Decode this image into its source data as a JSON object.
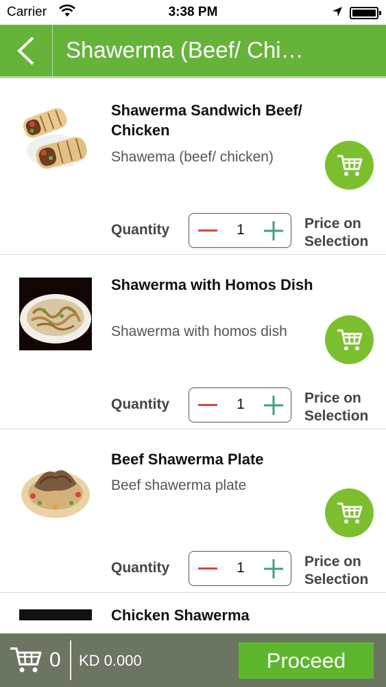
{
  "status_bar": {
    "carrier": "Carrier",
    "time": "3:38 PM"
  },
  "nav": {
    "title": "Shawerma (Beef/ Chi…"
  },
  "products": [
    {
      "name": "Shawerma Sandwich Beef/ Chicken",
      "description": "Shawema (beef/ chicken)",
      "quantity_label": "Quantity",
      "quantity": "1",
      "price": "Price on Selection",
      "image": "shawerma-sandwich-photo"
    },
    {
      "name": "Shawerma with Homos Dish",
      "description": "Shawerma with homos dish",
      "quantity_label": "Quantity",
      "quantity": "1",
      "price": "Price on Selection",
      "image": "shawerma-homos-dish-photo"
    },
    {
      "name": "Beef Shawerma Plate",
      "description": "Beef shawerma plate",
      "quantity_label": "Quantity",
      "quantity": "1",
      "price": "Price on Selection",
      "image": "beef-shawerma-plate-photo"
    },
    {
      "name": "Chicken Shawerma",
      "image": "chicken-shawerma-photo"
    }
  ],
  "bottom_bar": {
    "cart_count": "0",
    "total": "KD 0.000",
    "proceed_label": "Proceed"
  },
  "colors": {
    "brand_green": "#66b33a",
    "cart_button_green": "#7cbf2e",
    "minus_red": "#c94a4a",
    "plus_teal": "#3aa27a",
    "bottom_bar": "#6b7561"
  }
}
